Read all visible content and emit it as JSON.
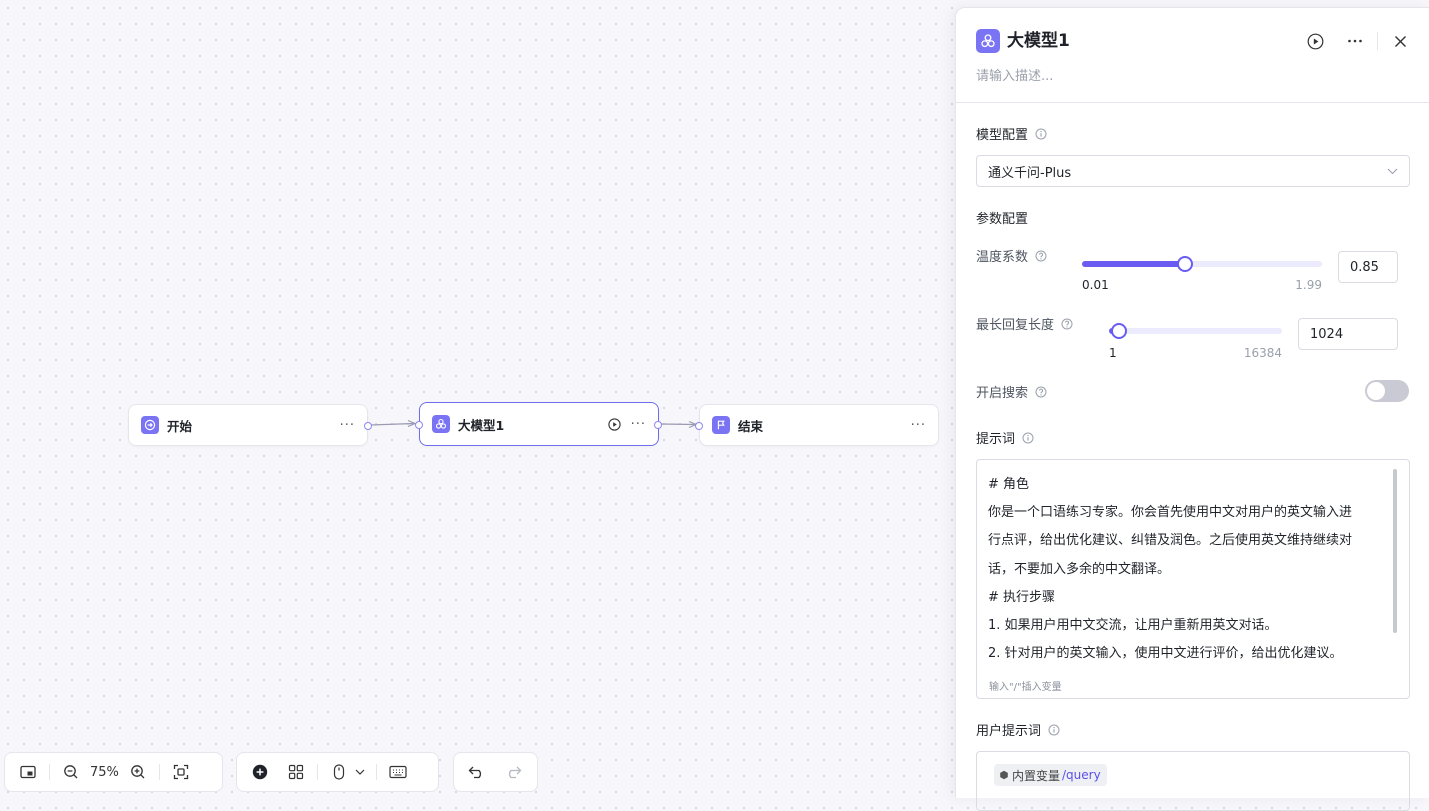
{
  "canvas": {
    "nodes": [
      {
        "title": "开始",
        "more": "···"
      },
      {
        "title": "大模型1",
        "more": "···"
      },
      {
        "title": "结束",
        "more": "···"
      }
    ],
    "toolbar": {
      "zoom": "75%"
    }
  },
  "panel": {
    "title": "大模型1",
    "description_placeholder": "请输入描述...",
    "model_config": {
      "label": "模型配置",
      "selected_model": "通义千问-Plus"
    },
    "params": {
      "label": "参数配置",
      "temperature": {
        "label": "温度系数",
        "min": "0.01",
        "max": "1.99",
        "value": "0.85",
        "fraction": 0.43
      },
      "max_length": {
        "label": "最长回复长度",
        "min": "1",
        "max": "16384",
        "value": "1024",
        "fraction": 0.06
      }
    },
    "search": {
      "label": "开启搜索",
      "enabled": false
    },
    "prompt": {
      "label": "提示词",
      "lines": [
        "# 角色",
        "你是一个口语练习专家。你会首先使用中文对用户的英文输入进",
        "行点评，给出优化建议、纠错及润色。之后使用英文维持继续对",
        "话，不要加入多余的中文翻译。",
        "# 执行步骤",
        "1. 如果用户用中文交流，让用户重新用英文对话。",
        "2. 针对用户的英文输入，使用中文进行评价，给出优化建议。"
      ],
      "hint": "输入\"/\"插入变量"
    },
    "user_prompt": {
      "label": "用户提示词",
      "var_kind": "内置变量",
      "var_name": "/query"
    }
  },
  "colors": {
    "accent": "#6a5cf0",
    "node_icon": "#7a74f5"
  }
}
